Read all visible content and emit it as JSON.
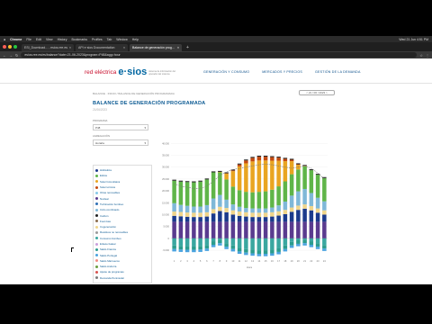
{
  "menubar": {
    "brand": "Chrome",
    "items": [
      "File",
      "Edit",
      "View",
      "History",
      "Bookmarks",
      "Profiles",
      "Tab",
      "Window",
      "Help"
    ],
    "clock": "Wed 21 Jun 4:51 PM"
  },
  "tabs": [
    {
      "label": "ESI_Download... - esios.ree.es"
    },
    {
      "label": "API e·sios Documentation"
    },
    {
      "label": "Balance de generación prog..."
    }
  ],
  "browser": {
    "url": "esios.ree.es/es/balance?date=21-06-2023&program=P48&agg=hour"
  },
  "site": {
    "logo_primary": "red eléctrica",
    "logo_brand": "e·sios",
    "logo_tagline": "sistema de información del operador del sistema",
    "nav": [
      "GENERACIÓN Y CONSUMO",
      "MERCADOS Y PRECIOS",
      "GESTIÓN DE LA DEMANDA"
    ],
    "breadcrumb": "BALANCE · INICIO / BALANCE DE GENERACIÓN PROGRAMADA",
    "date_pill": "< 21 / 06 / 2023 >",
    "title": "BALANCE DE GENERACIÓN PROGRAMADA",
    "subtitle": "21/06/2023",
    "filter1_label": "PROGRAMA",
    "filter1_value": "P48",
    "filter2_label": "AGREGACIÓN",
    "filter2_value": "Horaria",
    "legend": [
      {
        "label": "Hidráulica",
        "color": "#1b3a8c"
      },
      {
        "label": "Eólica",
        "color": "#5fb548"
      },
      {
        "label": "Solar fotovoltaica",
        "color": "#e9a521"
      },
      {
        "label": "Solar térmica",
        "color": "#c44a0f"
      },
      {
        "label": "Otras renovables",
        "color": "#87c9e8"
      },
      {
        "label": "Nuclear",
        "color": "#5a3b8f"
      },
      {
        "label": "Turbinación bombeo",
        "color": "#2f6fb5"
      },
      {
        "label": "Ciclo combinado",
        "color": "#7fb8d8"
      },
      {
        "label": "Carbón",
        "color": "#222222"
      },
      {
        "label": "Fuel-Gas",
        "color": "#8c6d4f"
      },
      {
        "label": "Cogeneración",
        "color": "#f0d58a"
      },
      {
        "label": "Residuos no renovables",
        "color": "#9b9b9b"
      },
      {
        "label": "Consumo bombeo",
        "color": "#3aa7a0"
      },
      {
        "label": "Enlace balear",
        "color": "#c9a0dc"
      },
      {
        "label": "Saldo Francia",
        "color": "#2b9c8e"
      },
      {
        "label": "Saldo Portugal",
        "color": "#4aa3df"
      },
      {
        "label": "Saldo Marruecos",
        "color": "#f28b82"
      },
      {
        "label": "Saldo Andorra",
        "color": "#6a9e3f"
      },
      {
        "label": "Ajuste de programas",
        "color": "#d9534f"
      },
      {
        "label": "Demanda Peninsular",
        "color": "#7a7a7a"
      }
    ]
  },
  "chart_data": {
    "type": "bar",
    "stacked": true,
    "categories": [
      "1",
      "2",
      "3",
      "4",
      "5",
      "6",
      "7",
      "8",
      "9",
      "10",
      "11",
      "12",
      "13",
      "14",
      "15",
      "16",
      "17",
      "18",
      "19",
      "20",
      "21",
      "22",
      "23",
      "24"
    ],
    "xlabel": "Hora",
    "ylim": [
      -8000,
      42000
    ],
    "yticks": [
      -5000,
      0,
      5000,
      10000,
      15000,
      20000,
      25000,
      30000,
      35000,
      40000
    ],
    "series": [
      {
        "name": "Nuclear",
        "color": "#5a3b8f",
        "values": [
          7000,
          7000,
          7000,
          7000,
          7000,
          7000,
          7000,
          7000,
          7000,
          7000,
          7000,
          7000,
          7000,
          7000,
          7000,
          7000,
          7000,
          7000,
          7000,
          7000,
          7000,
          7000,
          7000,
          7000
        ]
      },
      {
        "name": "Hidráulica",
        "color": "#1b3a8c",
        "values": [
          2500,
          2300,
          2100,
          2000,
          2000,
          2200,
          3500,
          4500,
          4000,
          3000,
          2500,
          2200,
          2000,
          2000,
          2000,
          2200,
          2600,
          3200,
          4200,
          5000,
          5500,
          4800,
          3800,
          3000
        ]
      },
      {
        "name": "Cogeneración",
        "color": "#f0d58a",
        "values": [
          1800,
          1800,
          1800,
          1800,
          1800,
          1800,
          1800,
          1800,
          1800,
          1800,
          1800,
          1800,
          1800,
          1800,
          1800,
          1800,
          1800,
          1800,
          1800,
          1800,
          1800,
          1800,
          1800,
          1800
        ]
      },
      {
        "name": "Ciclo combinado",
        "color": "#7fb8d8",
        "values": [
          3500,
          3000,
          2800,
          2600,
          2600,
          3000,
          4500,
          5000,
          3500,
          2500,
          2000,
          1800,
          1800,
          1800,
          1800,
          2000,
          2500,
          3500,
          5000,
          6000,
          6500,
          5500,
          4500,
          3800
        ]
      },
      {
        "name": "Eólica",
        "color": "#5fb548",
        "values": [
          9500,
          9800,
          10000,
          10200,
          10500,
          10800,
          11000,
          9500,
          8500,
          7500,
          7000,
          6800,
          6800,
          7000,
          7200,
          7500,
          8000,
          8500,
          9000,
          9200,
          9500,
          9600,
          9700,
          9800
        ]
      },
      {
        "name": "Solar fotovoltaica",
        "color": "#e9a521",
        "values": [
          0,
          0,
          0,
          0,
          0,
          0,
          0,
          200,
          2500,
          6500,
          10000,
          12000,
          13000,
          13200,
          13000,
          12200,
          10800,
          8500,
          5500,
          2000,
          200,
          0,
          0,
          0
        ]
      },
      {
        "name": "Solar térmica",
        "color": "#c44a0f",
        "values": [
          0,
          0,
          0,
          0,
          0,
          0,
          0,
          0,
          100,
          300,
          800,
          1200,
          1500,
          1600,
          1600,
          1500,
          1300,
          1000,
          600,
          200,
          0,
          0,
          0,
          0
        ]
      },
      {
        "name": "Carbón",
        "color": "#222222",
        "values": [
          400,
          400,
          400,
          400,
          400,
          400,
          400,
          400,
          400,
          400,
          400,
          400,
          400,
          400,
          400,
          400,
          400,
          400,
          400,
          400,
          400,
          400,
          400,
          400
        ]
      },
      {
        "name": "Consumo bombeo",
        "color": "#3aa7a0",
        "values": [
          -3000,
          -3200,
          -3300,
          -3300,
          -3200,
          -2800,
          -1200,
          -500,
          -2000,
          -3000,
          -4000,
          -4500,
          -4800,
          -5000,
          -5000,
          -4800,
          -4200,
          -3000,
          -1500,
          -800,
          -500,
          -1200,
          -2000,
          -2800
        ]
      },
      {
        "name": "Saldo Francia",
        "color": "#2b9c8e",
        "values": [
          -1500,
          -1500,
          -1500,
          -1500,
          -1500,
          -1500,
          -1500,
          -1500,
          -1500,
          -1500,
          -1500,
          -1500,
          -1500,
          -1500,
          -1500,
          -1500,
          -1500,
          -1500,
          -1500,
          -1500,
          -1500,
          -1500,
          -1500,
          -1500
        ]
      },
      {
        "name": "Saldo Portugal",
        "color": "#4aa3df",
        "values": [
          -1000,
          -1000,
          -1000,
          -1000,
          -1000,
          -1000,
          -1000,
          -1000,
          -1000,
          -1000,
          -1000,
          -1000,
          -1000,
          -1000,
          -1000,
          -1000,
          -1000,
          -1000,
          -1000,
          -1000,
          -1000,
          -1000,
          -1000,
          -1000
        ]
      }
    ],
    "line": {
      "name": "Demanda Peninsular",
      "color": "#7a7a7a",
      "values": [
        23000,
        22000,
        21500,
        21000,
        21000,
        22000,
        24000,
        26500,
        28000,
        29000,
        29500,
        30000,
        30500,
        31000,
        31200,
        31000,
        30500,
        30000,
        29500,
        30000,
        30500,
        29500,
        27500,
        25000
      ]
    }
  }
}
